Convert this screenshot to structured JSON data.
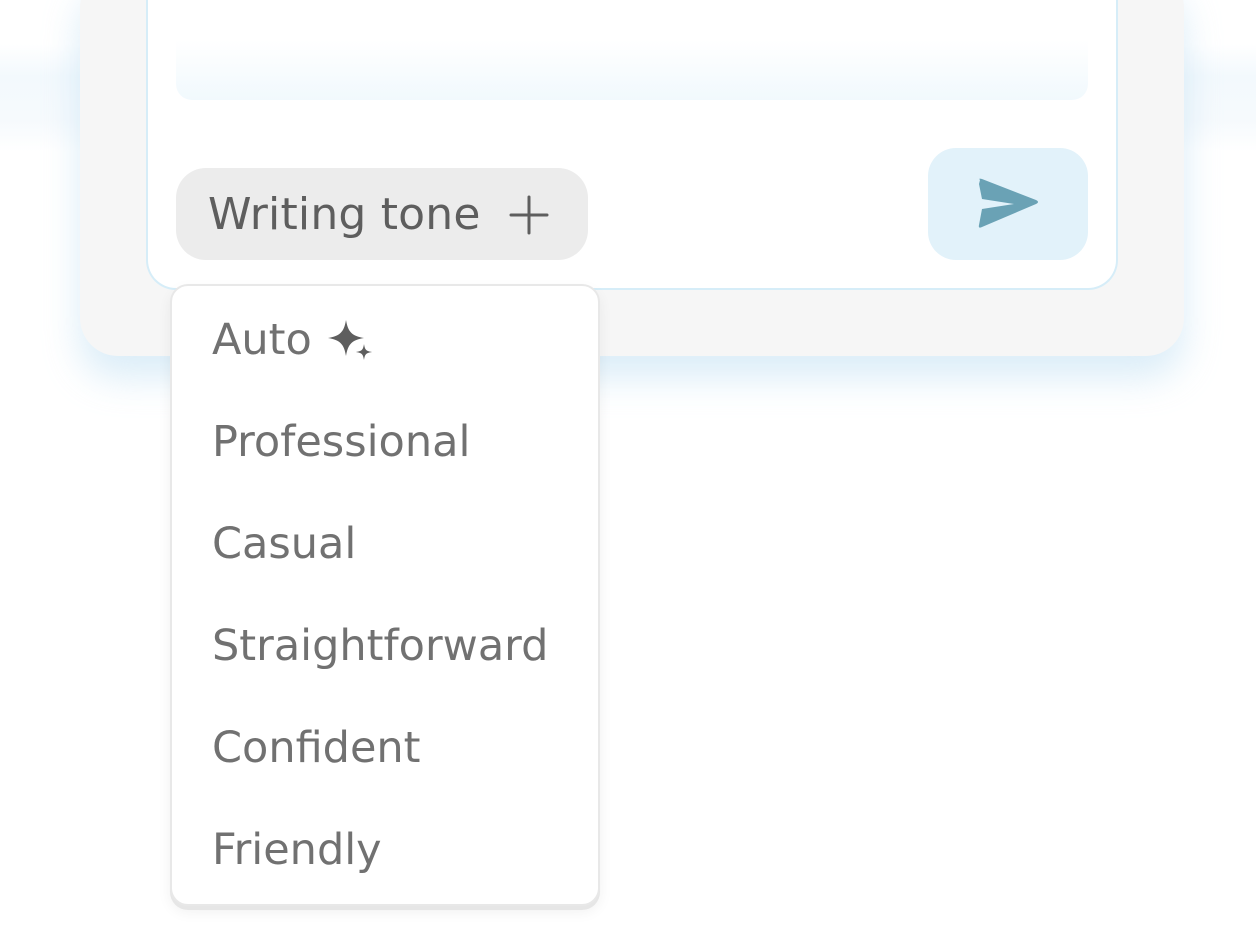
{
  "composer": {
    "tone_button_label": "Writing tone",
    "send_button_aria": "Send"
  },
  "tone_menu": {
    "items": [
      {
        "label": "Auto",
        "icon": "sparkle-icon"
      },
      {
        "label": "Professional"
      },
      {
        "label": "Casual"
      },
      {
        "label": "Straightforward"
      },
      {
        "label": "Confident"
      },
      {
        "label": "Friendly"
      }
    ]
  },
  "colors": {
    "send_icon": "#6aa2b5",
    "send_button_bg": "#e2f2fa",
    "tone_button_bg": "#ececec",
    "card_border": "#d6edf8"
  },
  "icons": {
    "tone_button": "plus-icon",
    "send_button": "send-icon"
  }
}
